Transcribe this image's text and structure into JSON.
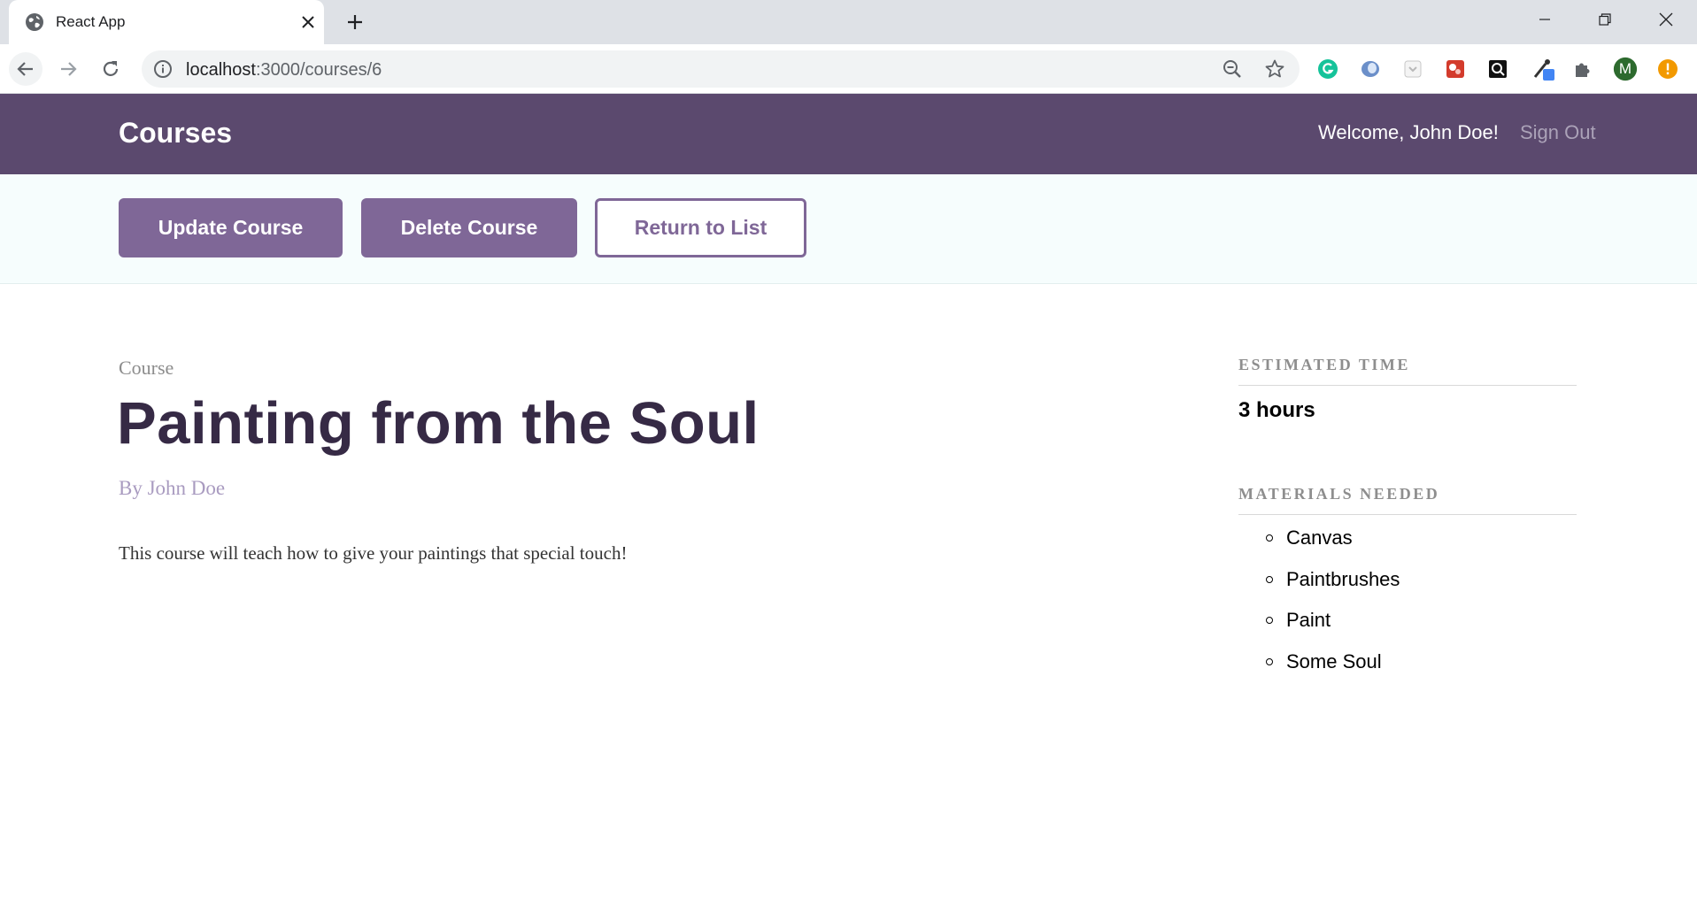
{
  "browser": {
    "tab_title": "React App",
    "url_host": "localhost",
    "url_path": ":3000/courses/6",
    "profile_initial": "M"
  },
  "header": {
    "brand": "Courses",
    "welcome": "Welcome, John Doe!",
    "sign_out": "Sign Out"
  },
  "actions": {
    "update": "Update Course",
    "delete": "Delete Course",
    "return": "Return to List"
  },
  "course": {
    "label": "Course",
    "title": "Painting from the Soul",
    "author": "By John Doe",
    "description": "This course will teach how to give your paintings that special touch!"
  },
  "sidebar": {
    "estimated_time_heading": "ESTIMATED TIME",
    "estimated_time": "3 hours",
    "materials_heading": "MATERIALS NEEDED",
    "materials": [
      "Canvas",
      "Paintbrushes",
      "Paint",
      "Some Soul"
    ]
  },
  "colors": {
    "header_bg": "#5b496e",
    "accent": "#7f6797",
    "title_text": "#362a45",
    "action_bar_bg": "#f6fdfd"
  },
  "icons": {
    "tab": "globe-icon",
    "back": "arrow-left-icon",
    "forward": "arrow-right-icon",
    "reload": "reload-icon",
    "site_info": "info-icon",
    "zoom": "zoom-out-icon",
    "bookmark": "star-icon",
    "extensions": "puzzle-icon",
    "alert": "exclamation-icon"
  }
}
